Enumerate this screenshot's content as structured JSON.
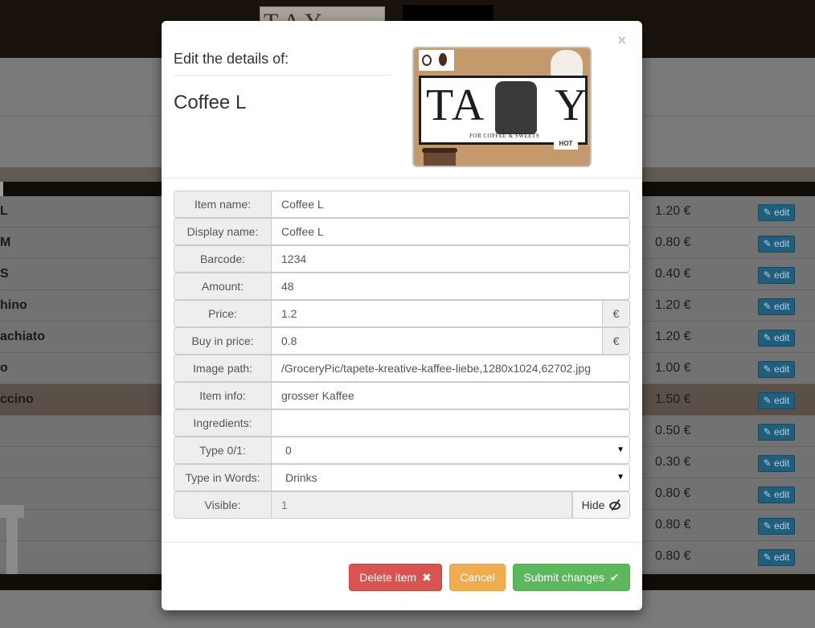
{
  "background": {
    "rows": [
      {
        "name": "L",
        "price": "1.20 €",
        "edit": "edit",
        "highlighted": false
      },
      {
        "name": "M",
        "price": "0.80 €",
        "edit": "edit",
        "highlighted": false
      },
      {
        "name": "S",
        "price": "0.40 €",
        "edit": "edit",
        "highlighted": false
      },
      {
        "name": "hino",
        "price": "1.20 €",
        "edit": "edit",
        "highlighted": false
      },
      {
        "name": "achiato",
        "price": "1.20 €",
        "edit": "edit",
        "highlighted": false
      },
      {
        "name": "o",
        "price": "1.00 €",
        "edit": "edit",
        "highlighted": false
      },
      {
        "name": "ccino",
        "price": "1.50 €",
        "edit": "edit",
        "highlighted": true
      },
      {
        "name": "",
        "price": "0.50 €",
        "edit": "edit",
        "highlighted": false
      },
      {
        "name": "",
        "price": "0.30 €",
        "edit": "edit",
        "highlighted": false
      },
      {
        "name": "",
        "price": "0.80 €",
        "edit": "edit",
        "highlighted": false
      },
      {
        "name": "",
        "price": "0.80 €",
        "edit": "edit",
        "highlighted": false
      },
      {
        "name": "",
        "price": "0.80 €",
        "edit": "edit",
        "highlighted": false
      }
    ]
  },
  "modal": {
    "close": "×",
    "header_label": "Edit the details of:",
    "title": "Coffee L",
    "logo": {
      "main_text": "TA",
      "y_letter": "Y",
      "subtitle": "FOR COFFEE & SWEETS",
      "hot_label": "HOT"
    },
    "fields": {
      "item_name": {
        "label": "Item name:",
        "value": "Coffee L"
      },
      "display_name": {
        "label": "Display name:",
        "value": "Coffee L"
      },
      "barcode": {
        "label": "Barcode:",
        "value": "1234"
      },
      "amount": {
        "label": "Amount:",
        "value": "48"
      },
      "price": {
        "label": "Price:",
        "value": "1.2",
        "unit": "€"
      },
      "buy_in_price": {
        "label": "Buy in price:",
        "value": "0.8",
        "unit": "€"
      },
      "image_path": {
        "label": "Image path:",
        "value": "/GroceryPic/tapete-kreative-kaffee-liebe,1280x1024,62702.jpg"
      },
      "item_info": {
        "label": "Item info:",
        "value": "grosser Kaffee"
      },
      "ingredients": {
        "label": "Ingredients:",
        "value": ""
      },
      "type_01": {
        "label": "Type 0/1:",
        "value": "0"
      },
      "type_words": {
        "label": "Type in Words:",
        "value": "Drinks"
      },
      "visible": {
        "label": "Visible:",
        "value": "1",
        "button": "Hide"
      }
    },
    "footer": {
      "delete": "Delete item",
      "delete_icon": "✖",
      "cancel": "Cancel",
      "submit": "Submit changes",
      "submit_icon": "✔"
    }
  },
  "colors": {
    "danger": "#d9534f",
    "warning": "#f0ad4e",
    "success": "#5cb85c",
    "edit_button": "#1e5f7d"
  }
}
